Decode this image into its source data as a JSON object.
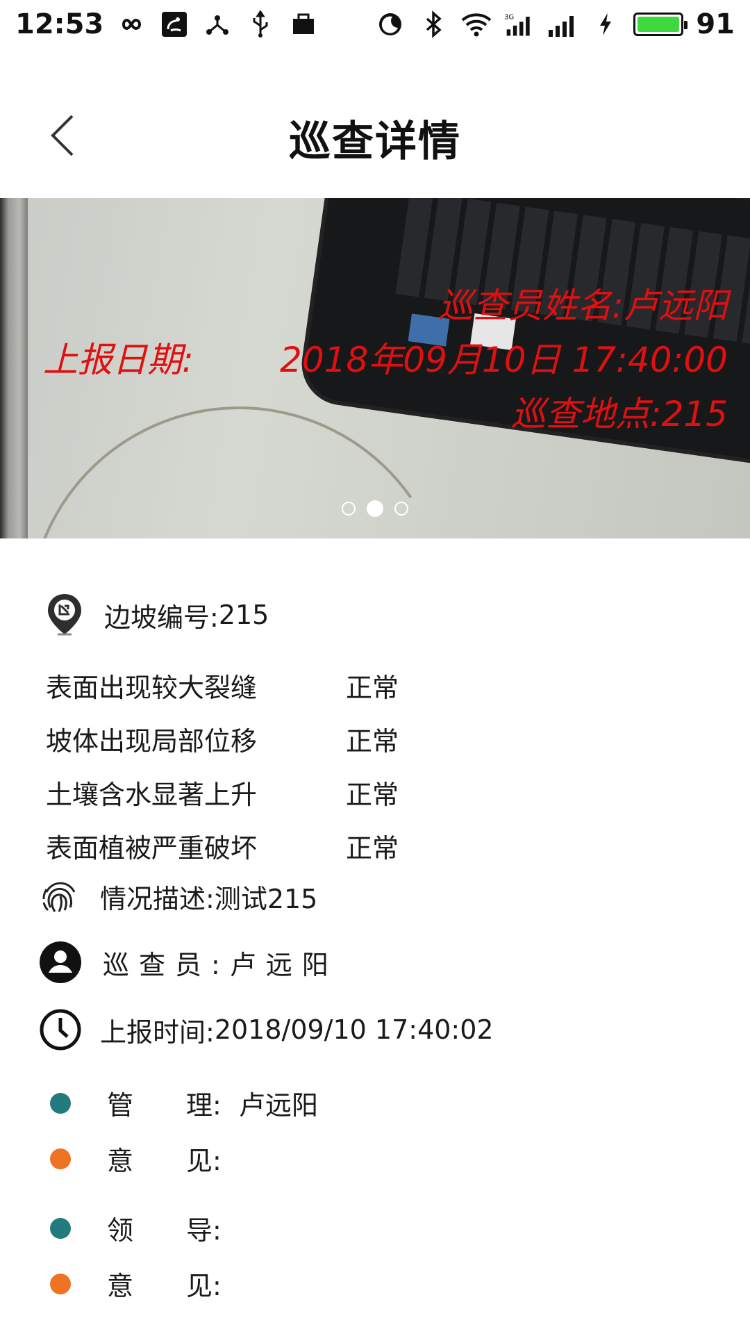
{
  "status_bar": {
    "time": "12:53",
    "battery": "91",
    "icons": [
      "infinity-icon",
      "uc-browser-icon",
      "share-icon",
      "usb-icon",
      "briefcase-icon",
      "do-not-disturb-icon",
      "bluetooth-icon",
      "wifi-icon",
      "signal-3g-icon",
      "signal-icon",
      "charging-icon",
      "battery-icon"
    ],
    "battery_color": "#3ed93e"
  },
  "header": {
    "title": "巡查详情",
    "back_icon": "chevron-left-icon"
  },
  "carousel": {
    "watermark_color": "#e01010",
    "watermark_inspector": "巡查员姓名:卢远阳",
    "watermark_date_label": "上报日期:",
    "watermark_date": "2018年09月10日 17:40:00",
    "watermark_place": "巡查地点:215",
    "page_count": 3,
    "active_index": 1
  },
  "details": {
    "slope_label": "边坡编号:",
    "slope_value": "215",
    "checks": [
      {
        "label": "表面出现较大裂缝",
        "status": "正常"
      },
      {
        "label": "坡体出现局部位移",
        "status": "正常"
      },
      {
        "label": "土壤含水显著上升",
        "status": "正常"
      },
      {
        "label": "表面植被严重破坏",
        "status": "正常"
      }
    ],
    "description_label": "情况描述:",
    "description_value": "测试215",
    "inspector_label": "巡查员:",
    "inspector_value": "卢远阳",
    "report_time_label": "上报时间:",
    "report_time_value": "2018/09/10 17:40:02"
  },
  "opinions": {
    "manager_label": "管　　理:",
    "manager_value": "卢远阳",
    "manager_opinion_label": "意　　见:",
    "manager_opinion_value": "",
    "leader_label": "领　　导:",
    "leader_value": "",
    "leader_opinion_label": "意　　见:",
    "leader_opinion_value": "",
    "teal": "#237b7e",
    "orange": "#ee7424"
  }
}
